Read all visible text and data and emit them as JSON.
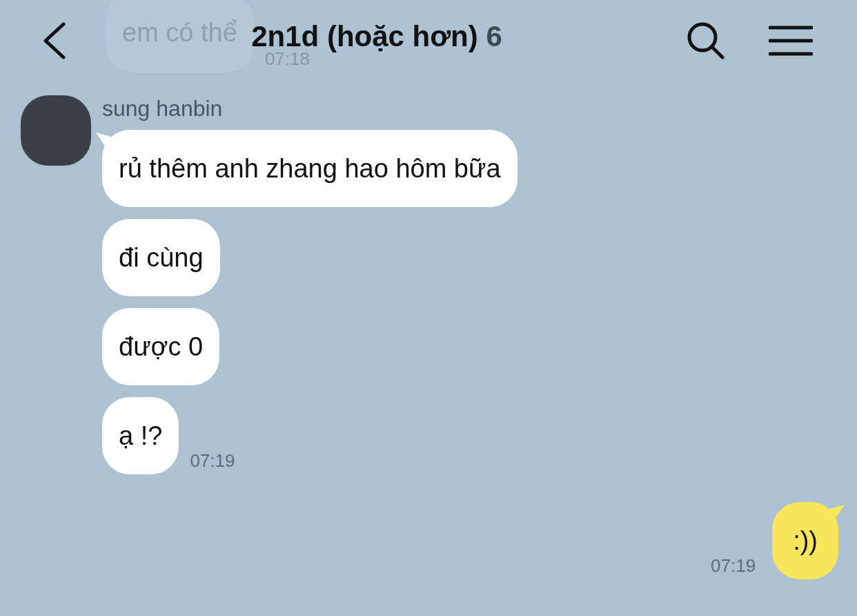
{
  "header": {
    "title": "2n1d (hoặc hơn)",
    "member_count": "6"
  },
  "earlier_message": {
    "text": "em có thể",
    "time": "07:18"
  },
  "incoming": {
    "sender": "sung hanbin",
    "bubbles": [
      "rủ thêm anh zhang hao hôm bữa",
      "đi cùng",
      "được 0",
      "ạ !?"
    ],
    "time": "07:19"
  },
  "outgoing": {
    "bubbles": [
      ":))"
    ],
    "time": "07:19"
  }
}
